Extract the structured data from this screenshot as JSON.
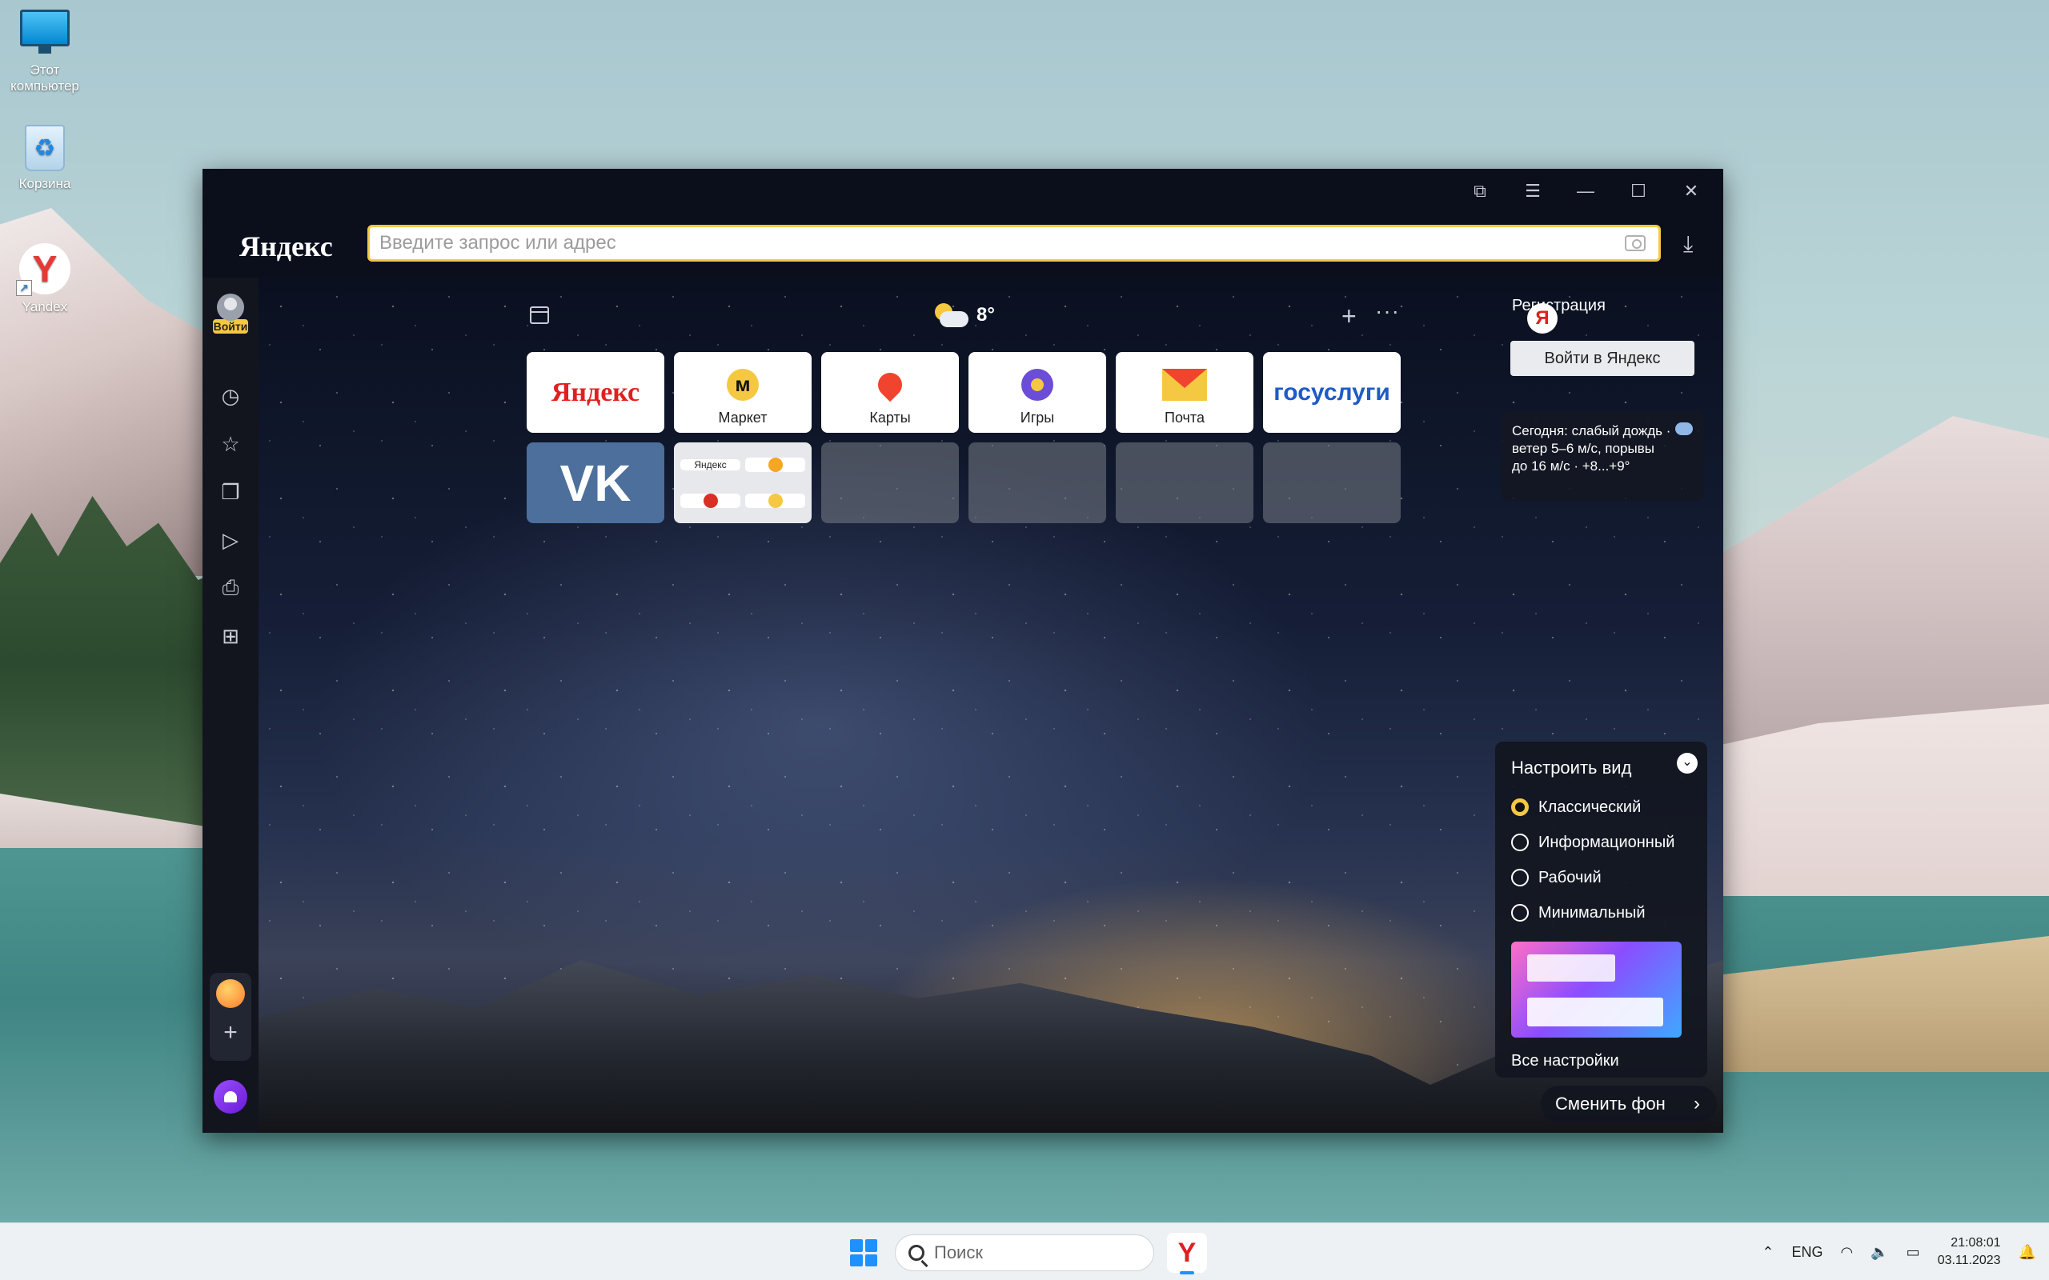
{
  "desktop": {
    "icons": [
      {
        "label": "Этот компьютер"
      },
      {
        "label": "Корзина"
      },
      {
        "label": "Yandex"
      }
    ]
  },
  "browser": {
    "logo": "Яндекс",
    "address_placeholder": "Введите запрос или адрес",
    "sidebar": {
      "login_badge": "Войти"
    },
    "weather": {
      "temp": "8°"
    },
    "tiles": [
      {
        "id": "yandex",
        "text": "Яндекс"
      },
      {
        "id": "market",
        "label": "Маркет"
      },
      {
        "id": "maps",
        "label": "Карты"
      },
      {
        "id": "games",
        "label": "Игры"
      },
      {
        "id": "mail",
        "label": "Почта"
      },
      {
        "id": "gosuslugi",
        "text": "госуслуги"
      },
      {
        "id": "vk",
        "text": "VK"
      },
      {
        "id": "group",
        "mini_text": "Яндекс"
      }
    ],
    "right_panel": {
      "registration": "Регистрация",
      "login_button": "Войти в Яндекс",
      "forecast": "Сегодня: слабый дождь · ветер 5–6 м/с, порывы до 16 м/с · +8...+9°"
    },
    "view_panel": {
      "title": "Настроить вид",
      "options": [
        {
          "label": "Классический",
          "selected": true
        },
        {
          "label": "Информационный",
          "selected": false
        },
        {
          "label": "Рабочий",
          "selected": false
        },
        {
          "label": "Минимальный",
          "selected": false
        }
      ],
      "all_settings": "Все настройки"
    },
    "change_background": "Сменить фон"
  },
  "taskbar": {
    "search_label": "Поиск",
    "lang": "ENG",
    "time": "21:08:01",
    "date": "03.11.2023"
  },
  "colors": {
    "accent_yellow": "#f5c842",
    "yandex_red": "#e02020",
    "vk_blue": "#4c6f9b"
  }
}
